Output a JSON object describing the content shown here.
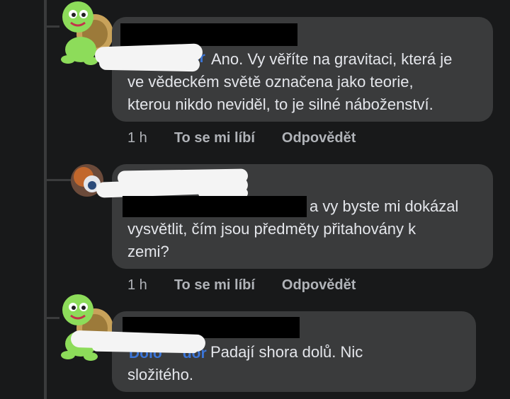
{
  "comments": [
    {
      "text_lines": [
        "Ano. Vy věříte na gravitaci, která je",
        "ve vědeckém světě označena jako teorie,",
        "kterou nikdo neviděl, to je silné náboženství."
      ],
      "time": "1 h",
      "like": "To se mi líbí",
      "reply": "Odpovědět",
      "tag_fragment": "dor"
    },
    {
      "text_lines": [
        "a vy byste mi dokázal",
        "vysvětlit, čím jsou předměty přitahovány k",
        "zemi?"
      ],
      "time": "1 h",
      "like": "To se mi líbí",
      "reply": "Odpovědět"
    },
    {
      "text_lines": [
        "Padají shora dolů. Nic",
        "složitého."
      ],
      "tag_fragment": "Dolo     dor"
    }
  ],
  "colors": {
    "background": "#18191a",
    "bubble": "#3a3b3c",
    "tag": "#3b75d8",
    "meta": "#b0b3b8"
  },
  "icons": {
    "turtle_avatar": "turtle-avatar-icon",
    "photo_avatar": "user-avatar-photo"
  }
}
